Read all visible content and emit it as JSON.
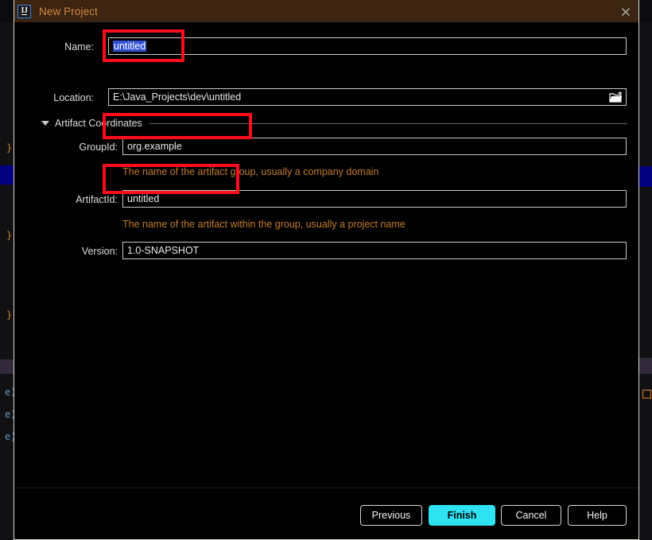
{
  "window": {
    "title": "New Project",
    "app_icon": "intellij-idea-icon",
    "icon_letters": "IJ",
    "close_icon": "close-icon",
    "titlebar_bg": "#3b2512",
    "title_color": "#d2863c"
  },
  "form": {
    "name": {
      "label": "Name:",
      "value": "untitled",
      "selected": true
    },
    "location": {
      "label": "Location:",
      "value": "E:\\Java_Projects\\dev\\untitled",
      "browse_icon": "folder-open-icon"
    },
    "section": {
      "title": "Artifact Coordinates",
      "expanded": true,
      "collapse_icon": "triangle-down-icon"
    },
    "group_id": {
      "label": "GroupId:",
      "value": "org.example",
      "hint": "The name of the artifact group, usually a company domain"
    },
    "artifact_id": {
      "label": "ArtifactId:",
      "value": "untitled",
      "hint": "The name of the artifact within the group, usually a project name"
    },
    "version": {
      "label": "Version:",
      "value": "1.0-SNAPSHOT"
    }
  },
  "footer": {
    "previous": "Previous",
    "finish": "Finish",
    "cancel": "Cancel",
    "help": "Help",
    "primary_color": "#2ee2f2"
  },
  "annotations": {
    "color": "#fc0d1b",
    "boxes": [
      "name-field",
      "groupid-field",
      "artifactid-field"
    ]
  },
  "background": {
    "tokens": [
      "}",
      "}",
      "}",
      "e)",
      "e)",
      "e)"
    ]
  }
}
